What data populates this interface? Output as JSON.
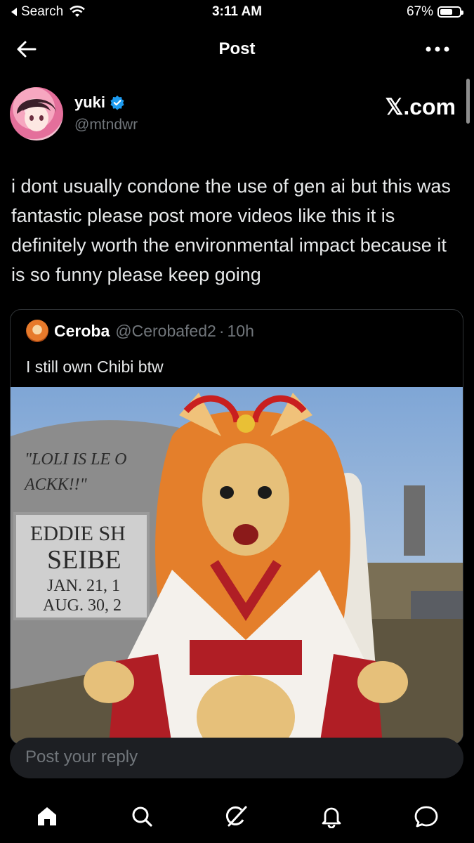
{
  "status": {
    "back_label": "Search",
    "time": "3:11 AM",
    "battery": "67%",
    "battery_level": 0.67
  },
  "nav": {
    "title": "Post",
    "more_icon": "more-horizontal-icon",
    "back_icon": "arrow-left-icon"
  },
  "author": {
    "name": "yuki",
    "handle": "@mtndwr",
    "verified": true,
    "source": "𝕏.com"
  },
  "tweet": {
    "text": "i dont usually condone the use of gen ai but this was fantastic please post more videos like this it is definitely worth the environmental impact because it is so funny please keep going"
  },
  "quote": {
    "name": "Ceroba",
    "handle": "@Cerobafed2",
    "separator": "·",
    "time": "10h",
    "text": "I still own Chibi btw",
    "media": {
      "gravestone_lines": [
        "\"LOLI IS LE O",
        "ACKK!!\"",
        "EDDIE SH",
        "SEIBE",
        "JAN. 21, 1",
        "AUG. 30, 2"
      ]
    }
  },
  "reply": {
    "placeholder": "Post your reply"
  },
  "tabs": [
    {
      "icon": "home-icon"
    },
    {
      "icon": "search-icon"
    },
    {
      "icon": "grok-icon"
    },
    {
      "icon": "notifications-icon"
    },
    {
      "icon": "messages-icon"
    }
  ],
  "colors": {
    "background": "#000000",
    "text": "#e7e9ea",
    "muted": "#71767b",
    "border": "#2f3336",
    "verified": "#1d9bf0",
    "reply_bg": "#1d1f23"
  }
}
